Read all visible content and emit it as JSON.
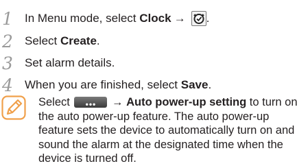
{
  "steps": [
    {
      "num": "1",
      "pre": "In Menu mode, select ",
      "bold": "Clock",
      "arrow": "→"
    },
    {
      "num": "2",
      "pre": "Select ",
      "bold": "Create",
      "post": "."
    },
    {
      "num": "3",
      "pre": "Set alarm details."
    },
    {
      "num": "4",
      "pre": "When you are finished, select ",
      "bold": "Save",
      "post": "."
    }
  ],
  "step1_end": ".",
  "note": {
    "pre": "Select ",
    "button_glyph": "•••",
    "arrow": "→",
    "bold": "Auto power-up setting",
    "rest": " to turn on the auto power-up feature. The auto power-up feature sets the device to automatically turn on and sound the alarm at the designated time when the device is turned off."
  },
  "icons": [
    "clock-icon",
    "note-icon",
    "menu-dots-icon"
  ],
  "colors": {
    "step_number": "#9a9a9a",
    "note_icon": "#f0a04b",
    "text": "#231f20"
  }
}
